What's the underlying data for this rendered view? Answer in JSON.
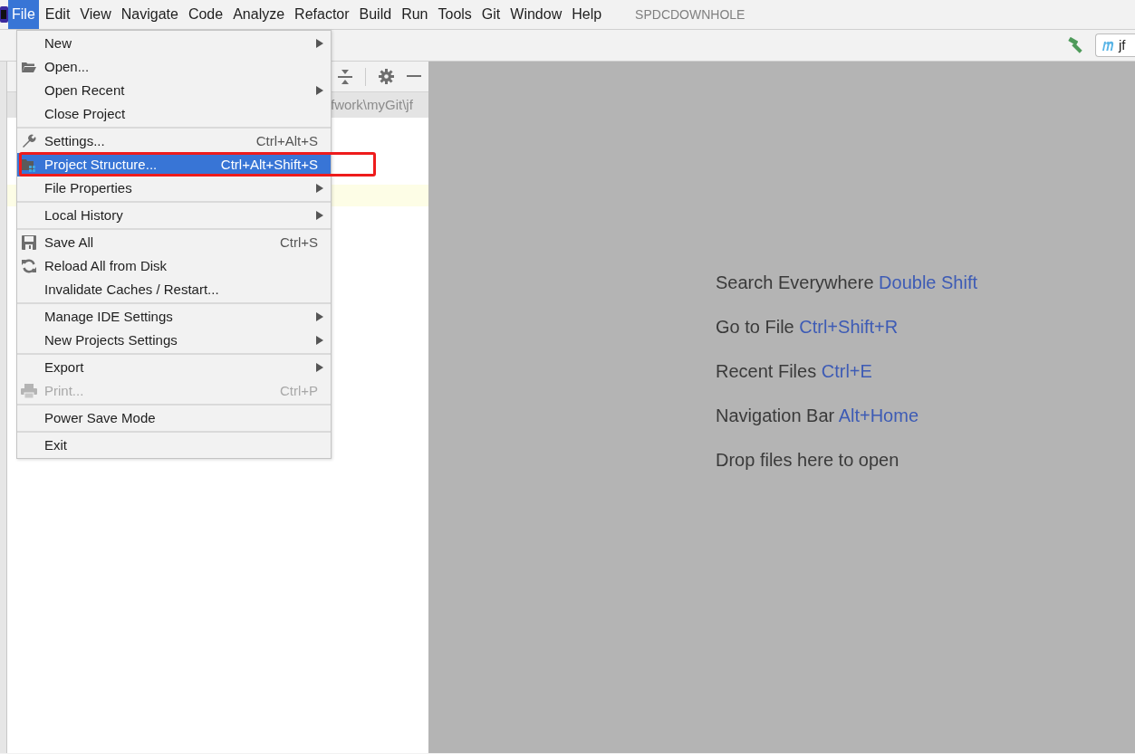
{
  "menubar": {
    "items": [
      {
        "label": "File",
        "selected": true
      },
      {
        "label": "Edit",
        "selected": false
      },
      {
        "label": "View",
        "selected": false
      },
      {
        "label": "Navigate",
        "selected": false
      },
      {
        "label": "Code",
        "selected": false
      },
      {
        "label": "Analyze",
        "selected": false
      },
      {
        "label": "Refactor",
        "selected": false
      },
      {
        "label": "Build",
        "selected": false
      },
      {
        "label": "Run",
        "selected": false
      },
      {
        "label": "Tools",
        "selected": false
      },
      {
        "label": "Git",
        "selected": false
      },
      {
        "label": "Window",
        "selected": false
      },
      {
        "label": "Help",
        "selected": false
      }
    ],
    "project_name": "SPDCDOWNHOLE"
  },
  "toolbar": {
    "config_field": {
      "value": "jf"
    }
  },
  "project_panel": {
    "path": "fwork\\myGit\\jf"
  },
  "file_menu": {
    "groups": [
      [
        {
          "label": "New",
          "kind": "plain",
          "submenu": true,
          "selected": false,
          "disabled": false
        },
        {
          "label": "Open...",
          "kind": "folder",
          "submenu": false,
          "selected": false,
          "disabled": false
        },
        {
          "label": "Open Recent",
          "kind": "plain",
          "submenu": true,
          "selected": false,
          "disabled": false
        },
        {
          "label": "Close Project",
          "kind": "plain",
          "submenu": false,
          "selected": false,
          "disabled": false
        }
      ],
      [
        {
          "label": "Settings...",
          "shortcut": "Ctrl+Alt+S",
          "kind": "wrench",
          "submenu": false,
          "selected": false,
          "disabled": false
        },
        {
          "label": "Project Structure...",
          "shortcut": "Ctrl+Alt+Shift+S",
          "kind": "structure",
          "submenu": false,
          "selected": true,
          "disabled": false,
          "highlighted": true
        },
        {
          "label": "File Properties",
          "kind": "plain",
          "submenu": true,
          "selected": false,
          "disabled": false
        }
      ],
      [
        {
          "label": "Local History",
          "kind": "plain",
          "submenu": true,
          "selected": false,
          "disabled": false
        }
      ],
      [
        {
          "label": "Save All",
          "shortcut": "Ctrl+S",
          "kind": "save",
          "submenu": false,
          "selected": false,
          "disabled": false
        },
        {
          "label": "Reload All from Disk",
          "kind": "reload",
          "submenu": false,
          "selected": false,
          "disabled": false
        },
        {
          "label": "Invalidate Caches / Restart...",
          "kind": "plain",
          "submenu": false,
          "selected": false,
          "disabled": false
        }
      ],
      [
        {
          "label": "Manage IDE Settings",
          "kind": "plain",
          "submenu": true,
          "selected": false,
          "disabled": false
        },
        {
          "label": "New Projects Settings",
          "kind": "plain",
          "submenu": true,
          "selected": false,
          "disabled": false
        }
      ],
      [
        {
          "label": "Export",
          "kind": "plain",
          "submenu": true,
          "selected": false,
          "disabled": false
        },
        {
          "label": "Print...",
          "shortcut": "Ctrl+P",
          "kind": "printer",
          "submenu": false,
          "selected": false,
          "disabled": true
        }
      ],
      [
        {
          "label": "Power Save Mode",
          "kind": "plain",
          "submenu": false,
          "selected": false,
          "disabled": false
        }
      ],
      [
        {
          "label": "Exit",
          "kind": "plain",
          "submenu": false,
          "selected": false,
          "disabled": false
        }
      ]
    ]
  },
  "editor_hints": [
    {
      "text": "Search Everywhere",
      "shortcut": "Double Shift"
    },
    {
      "text": "Go to File",
      "shortcut": "Ctrl+Shift+R"
    },
    {
      "text": "Recent Files",
      "shortcut": "Ctrl+E"
    },
    {
      "text": "Navigation Bar",
      "shortcut": "Alt+Home"
    },
    {
      "text": "Drop files here to open"
    }
  ]
}
